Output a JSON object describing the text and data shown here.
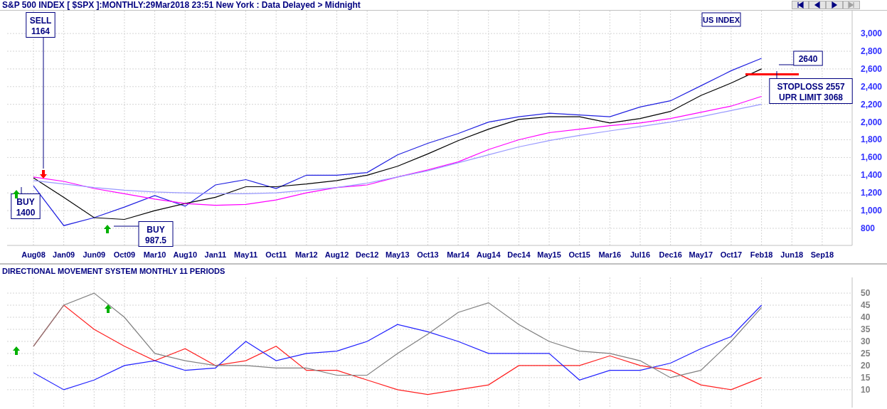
{
  "header": {
    "title": "S&P 500 INDEX [ $SPX ]:MONTHLY:29Mar2018 23:51 New York : Data Delayed > Midnight"
  },
  "nav_buttons": [
    {
      "kind": "first",
      "disabled": false
    },
    {
      "kind": "back",
      "disabled": false
    },
    {
      "kind": "forward",
      "disabled": false
    },
    {
      "kind": "last",
      "disabled": true
    }
  ],
  "price_chart": {
    "label": "US INDEX",
    "notes": [
      {
        "lines": [
          "SELL",
          "1164"
        ]
      },
      {
        "lines": [
          "BUY",
          "1400"
        ]
      },
      {
        "lines": [
          "BUY",
          "987.5"
        ]
      },
      {
        "lines": [
          "2640"
        ]
      },
      {
        "lines": [
          "STOPLOSS 2557",
          "UPR LIMIT 3068"
        ]
      }
    ],
    "signals": [
      {
        "kind": "sell"
      },
      {
        "kind": "buy"
      },
      {
        "kind": "buy"
      }
    ],
    "chart_data": {
      "type": "line",
      "grid": true,
      "categories": [
        "Aug08",
        "Jan09",
        "Jun09",
        "Oct09",
        "Mar10",
        "Aug10",
        "Jan11",
        "May11",
        "Oct11",
        "Mar12",
        "Aug12",
        "Dec12",
        "May13",
        "Oct13",
        "Mar14",
        "Aug14",
        "Dec14",
        "May15",
        "Oct15",
        "Mar16",
        "Jul16",
        "Dec16",
        "May17",
        "Oct17",
        "Feb18",
        "Jun18",
        "Sep18"
      ],
      "ylim": [
        607,
        3258
      ],
      "yticks": [
        {
          "value": 800,
          "label": "800"
        },
        {
          "value": 1000,
          "label": "1,000"
        },
        {
          "value": 1200,
          "label": "1,200"
        },
        {
          "value": 1400,
          "label": "1,400"
        },
        {
          "value": 1600,
          "label": "1,600"
        },
        {
          "value": 1800,
          "label": "1,800"
        },
        {
          "value": 2000,
          "label": "2,000"
        },
        {
          "value": 2200,
          "label": "2,200"
        },
        {
          "value": 2400,
          "label": "2,400"
        },
        {
          "value": 2600,
          "label": "2,600"
        },
        {
          "value": 2800,
          "label": "2,800"
        },
        {
          "value": 3000,
          "label": "3,000"
        }
      ],
      "series": [
        {
          "color": "#2020e0",
          "values": [
            1280,
            830,
            920,
            1040,
            1170,
            1050,
            1290,
            1350,
            1250,
            1400,
            1400,
            1430,
            1630,
            1760,
            1870,
            2000,
            2060,
            2100,
            2080,
            2060,
            2170,
            2240,
            2410,
            2580,
            2720,
            null,
            null
          ]
        },
        {
          "color": "#000000",
          "values": [
            1370,
            1150,
            920,
            900,
            1000,
            1080,
            1150,
            1270,
            1270,
            1300,
            1340,
            1400,
            1500,
            1640,
            1790,
            1920,
            2030,
            2060,
            2060,
            1990,
            2040,
            2120,
            2300,
            2440,
            2600,
            null,
            null
          ]
        },
        {
          "color": "#ff00ff",
          "values": [
            1380,
            1330,
            1250,
            1190,
            1130,
            1080,
            1060,
            1070,
            1120,
            1200,
            1260,
            1290,
            1380,
            1460,
            1550,
            1690,
            1800,
            1880,
            1920,
            1960,
            1990,
            2040,
            2110,
            2180,
            2290,
            null,
            null
          ]
        },
        {
          "color": "#9999ff",
          "values": [
            1340,
            1300,
            1260,
            1230,
            1210,
            1200,
            1190,
            1190,
            1200,
            1230,
            1260,
            1310,
            1380,
            1450,
            1540,
            1630,
            1720,
            1790,
            1850,
            1900,
            1950,
            2000,
            2060,
            2130,
            2200,
            null,
            null
          ]
        }
      ]
    }
  },
  "dms_chart": {
    "title": "DIRECTIONAL MOVEMENT SYSTEM MONTHLY 11 PERIODS",
    "signals": [
      {
        "kind": "buy"
      },
      {
        "kind": "buy"
      }
    ],
    "chart_data": {
      "type": "line",
      "grid": true,
      "ylim": [
        2.6,
        56.5
      ],
      "yticks": [
        10,
        15,
        20,
        25,
        30,
        35,
        40,
        45,
        50
      ],
      "series": [
        {
          "color": "#ff2020",
          "values": [
            28,
            45,
            35,
            28,
            22,
            27,
            20,
            22,
            28,
            18,
            18,
            14,
            10,
            8,
            10,
            12,
            20,
            20,
            20,
            24,
            20,
            18,
            12,
            10,
            15
          ]
        },
        {
          "color": "#2020ff",
          "values": [
            17,
            10,
            14,
            20,
            22,
            18,
            19,
            30,
            22,
            25,
            26,
            30,
            37,
            34,
            30,
            25,
            25,
            25,
            14,
            18,
            18,
            21,
            27,
            32,
            45
          ]
        },
        {
          "color": "#808080",
          "values": [
            28,
            45,
            50,
            40,
            25,
            22,
            20,
            20,
            19,
            19,
            16,
            16,
            25,
            33,
            42,
            46,
            37,
            30,
            26,
            25,
            22,
            15,
            18,
            30,
            44
          ]
        }
      ]
    }
  }
}
